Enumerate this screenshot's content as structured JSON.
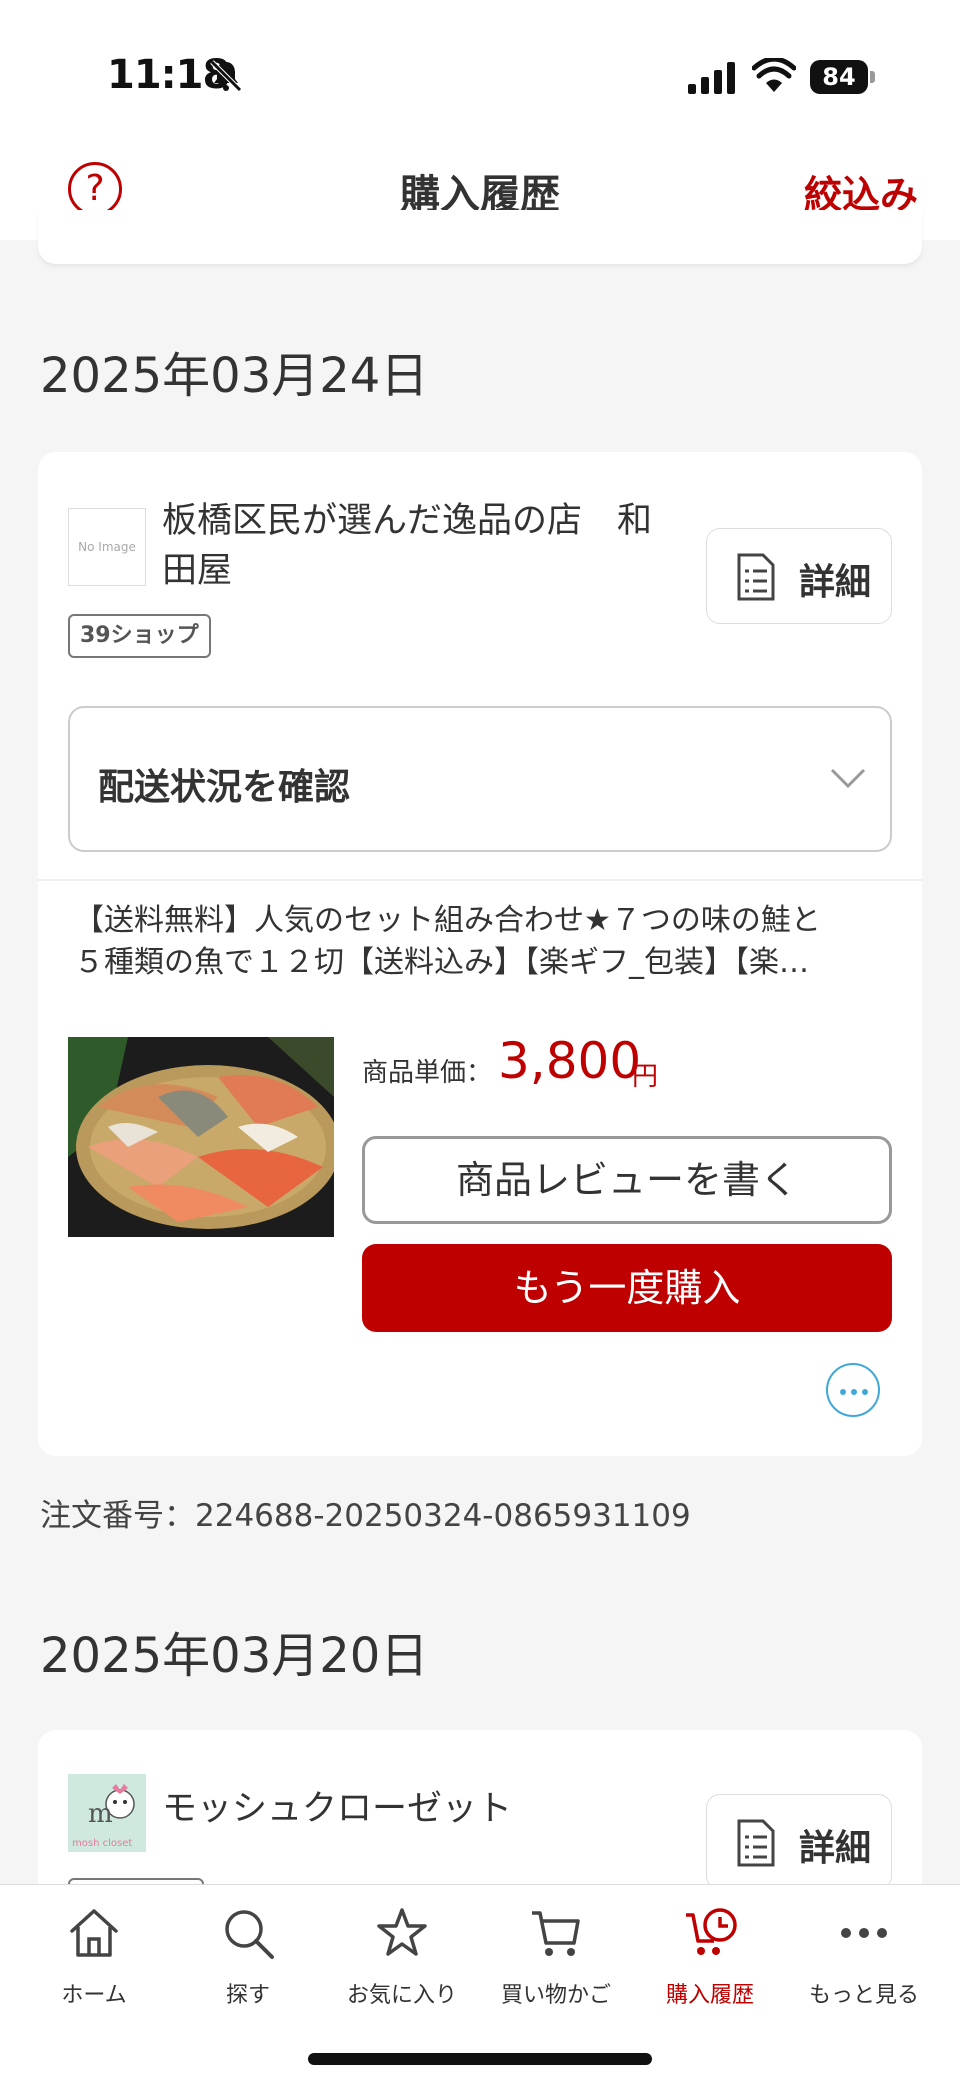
{
  "status_bar": {
    "time": "11:18",
    "battery": "84"
  },
  "header": {
    "title": "購入履歴",
    "filter_label": "絞込み",
    "help_label": "?"
  },
  "orders": [
    {
      "date": "2025年03月24日",
      "shop": {
        "name_line1": "板橋区民が選んだ逸品の店　和",
        "name_line2": "田屋",
        "logo_text": "No Image",
        "badge": "39ショップ"
      },
      "detail_label": "詳細",
      "shipping_label": "配送状況を確認",
      "product": {
        "title_line1": "【送料無料】人気のセット組み合わせ★７つの味の鮭と",
        "title_line2": "５種類の魚で１２切【送料込み】【楽ギフ_包装】【楽…",
        "price_label": "商品単価：",
        "price": "3,800",
        "price_unit": "円"
      },
      "review_button": "商品レビューを書く",
      "rebuy_button": "もう一度購入",
      "order_number": "注文番号：224688-20250324-0865931109"
    },
    {
      "date": "2025年03月20日",
      "shop": {
        "name_line1": "モッシュクローゼット",
        "logo_text": "mosh closet"
      },
      "detail_label": "詳細"
    }
  ],
  "bottom_nav": [
    {
      "label": "ホーム",
      "icon": "home-icon"
    },
    {
      "label": "探す",
      "icon": "search-icon"
    },
    {
      "label": "お気に入り",
      "icon": "star-icon"
    },
    {
      "label": "買い物かご",
      "icon": "cart-icon"
    },
    {
      "label": "購入履歴",
      "icon": "purchase-history-icon",
      "active": true
    },
    {
      "label": "もっと見る",
      "icon": "more-icon"
    }
  ],
  "colors": {
    "accent": "#bf0000",
    "link_blue": "#3fa8d8"
  }
}
